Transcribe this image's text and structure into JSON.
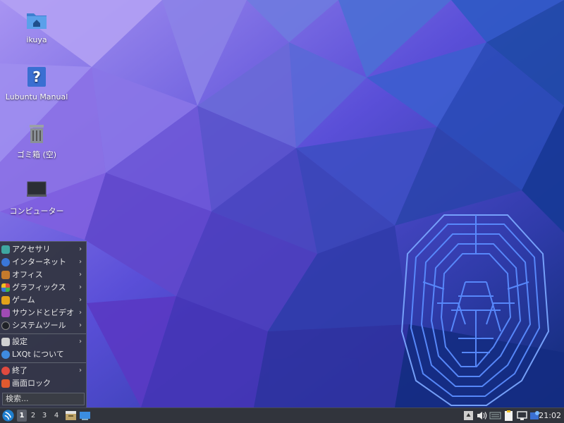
{
  "desktop": {
    "icons": [
      {
        "label": "ikuya",
        "icon": "home-folder-icon"
      },
      {
        "label": "Lubuntu Manual",
        "icon": "help-icon"
      },
      {
        "label": "ゴミ箱 (空)",
        "icon": "trash-icon"
      },
      {
        "label": "コンピューター",
        "icon": "computer-icon"
      }
    ]
  },
  "start_menu": {
    "items": [
      {
        "label": "アクセサリ",
        "icon": "accessories-icon",
        "color": "#3fa6a0",
        "submenu": true
      },
      {
        "label": "インターネット",
        "icon": "internet-icon",
        "color": "#3a77d8",
        "submenu": true
      },
      {
        "label": "オフィス",
        "icon": "office-icon",
        "color": "#c47a2c",
        "submenu": true
      },
      {
        "label": "グラフィックス",
        "icon": "graphics-icon",
        "color": "#d6543f",
        "submenu": true
      },
      {
        "label": "ゲーム",
        "icon": "games-icon",
        "color": "#e3a21a",
        "submenu": true
      },
      {
        "label": "サウンドとビデオ",
        "icon": "multimedia-icon",
        "color": "#a14bb5",
        "submenu": true
      },
      {
        "label": "システムツール",
        "icon": "system-tools-icon",
        "color": "#2a2d33",
        "submenu": true
      },
      {
        "label": "設定",
        "icon": "settings-icon",
        "color": "#d0d0d0",
        "submenu": true
      },
      {
        "label": "LXQt について",
        "icon": "about-lxqt-icon",
        "color": "#3f8be0",
        "submenu": false
      },
      {
        "label": "終了",
        "icon": "shutdown-icon",
        "color": "#e04a3f",
        "submenu": true
      },
      {
        "label": "画面ロック",
        "icon": "lock-screen-icon",
        "color": "#e05a2f",
        "submenu": false
      }
    ],
    "search_placeholder": "検索..."
  },
  "taskbar": {
    "workspaces": [
      "1",
      "2",
      "3",
      "4"
    ],
    "active_workspace": "1",
    "clock": "21:02"
  },
  "colors": {
    "panel": "#31343c",
    "menu": "#32353e",
    "wallpaper_top_left": "#a08af0",
    "wallpaper_bottom_right": "#0b2f7a",
    "maze": "#5a8cff"
  }
}
